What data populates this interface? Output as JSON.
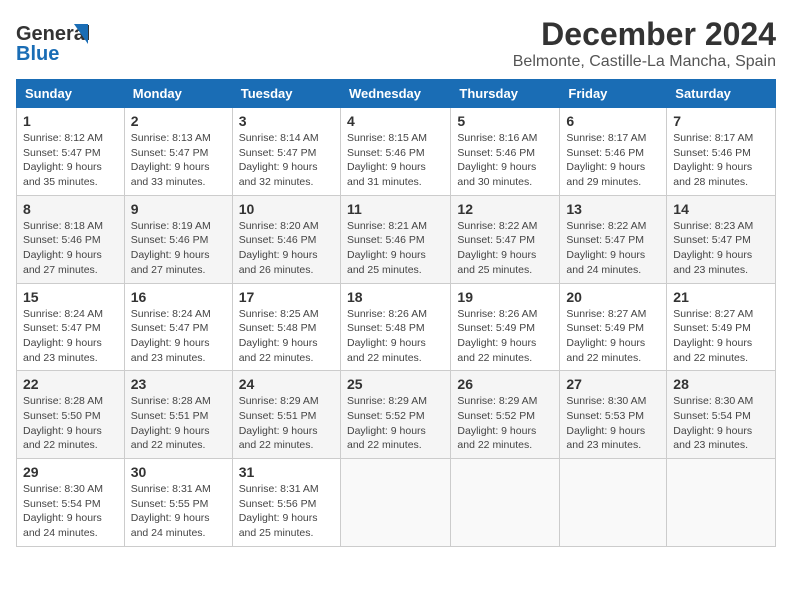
{
  "logo": {
    "line1": "General",
    "line2": "Blue"
  },
  "title": "December 2024",
  "subtitle": "Belmonte, Castille-La Mancha, Spain",
  "days_of_week": [
    "Sunday",
    "Monday",
    "Tuesday",
    "Wednesday",
    "Thursday",
    "Friday",
    "Saturday"
  ],
  "weeks": [
    [
      {
        "day": "1",
        "sunrise": "8:12 AM",
        "sunset": "5:47 PM",
        "daylight": "9 hours and 35 minutes."
      },
      {
        "day": "2",
        "sunrise": "8:13 AM",
        "sunset": "5:47 PM",
        "daylight": "9 hours and 33 minutes."
      },
      {
        "day": "3",
        "sunrise": "8:14 AM",
        "sunset": "5:47 PM",
        "daylight": "9 hours and 32 minutes."
      },
      {
        "day": "4",
        "sunrise": "8:15 AM",
        "sunset": "5:46 PM",
        "daylight": "9 hours and 31 minutes."
      },
      {
        "day": "5",
        "sunrise": "8:16 AM",
        "sunset": "5:46 PM",
        "daylight": "9 hours and 30 minutes."
      },
      {
        "day": "6",
        "sunrise": "8:17 AM",
        "sunset": "5:46 PM",
        "daylight": "9 hours and 29 minutes."
      },
      {
        "day": "7",
        "sunrise": "8:17 AM",
        "sunset": "5:46 PM",
        "daylight": "9 hours and 28 minutes."
      }
    ],
    [
      {
        "day": "8",
        "sunrise": "8:18 AM",
        "sunset": "5:46 PM",
        "daylight": "9 hours and 27 minutes."
      },
      {
        "day": "9",
        "sunrise": "8:19 AM",
        "sunset": "5:46 PM",
        "daylight": "9 hours and 27 minutes."
      },
      {
        "day": "10",
        "sunrise": "8:20 AM",
        "sunset": "5:46 PM",
        "daylight": "9 hours and 26 minutes."
      },
      {
        "day": "11",
        "sunrise": "8:21 AM",
        "sunset": "5:46 PM",
        "daylight": "9 hours and 25 minutes."
      },
      {
        "day": "12",
        "sunrise": "8:22 AM",
        "sunset": "5:47 PM",
        "daylight": "9 hours and 25 minutes."
      },
      {
        "day": "13",
        "sunrise": "8:22 AM",
        "sunset": "5:47 PM",
        "daylight": "9 hours and 24 minutes."
      },
      {
        "day": "14",
        "sunrise": "8:23 AM",
        "sunset": "5:47 PM",
        "daylight": "9 hours and 23 minutes."
      }
    ],
    [
      {
        "day": "15",
        "sunrise": "8:24 AM",
        "sunset": "5:47 PM",
        "daylight": "9 hours and 23 minutes."
      },
      {
        "day": "16",
        "sunrise": "8:24 AM",
        "sunset": "5:47 PM",
        "daylight": "9 hours and 23 minutes."
      },
      {
        "day": "17",
        "sunrise": "8:25 AM",
        "sunset": "5:48 PM",
        "daylight": "9 hours and 22 minutes."
      },
      {
        "day": "18",
        "sunrise": "8:26 AM",
        "sunset": "5:48 PM",
        "daylight": "9 hours and 22 minutes."
      },
      {
        "day": "19",
        "sunrise": "8:26 AM",
        "sunset": "5:49 PM",
        "daylight": "9 hours and 22 minutes."
      },
      {
        "day": "20",
        "sunrise": "8:27 AM",
        "sunset": "5:49 PM",
        "daylight": "9 hours and 22 minutes."
      },
      {
        "day": "21",
        "sunrise": "8:27 AM",
        "sunset": "5:49 PM",
        "daylight": "9 hours and 22 minutes."
      }
    ],
    [
      {
        "day": "22",
        "sunrise": "8:28 AM",
        "sunset": "5:50 PM",
        "daylight": "9 hours and 22 minutes."
      },
      {
        "day": "23",
        "sunrise": "8:28 AM",
        "sunset": "5:51 PM",
        "daylight": "9 hours and 22 minutes."
      },
      {
        "day": "24",
        "sunrise": "8:29 AM",
        "sunset": "5:51 PM",
        "daylight": "9 hours and 22 minutes."
      },
      {
        "day": "25",
        "sunrise": "8:29 AM",
        "sunset": "5:52 PM",
        "daylight": "9 hours and 22 minutes."
      },
      {
        "day": "26",
        "sunrise": "8:29 AM",
        "sunset": "5:52 PM",
        "daylight": "9 hours and 22 minutes."
      },
      {
        "day": "27",
        "sunrise": "8:30 AM",
        "sunset": "5:53 PM",
        "daylight": "9 hours and 23 minutes."
      },
      {
        "day": "28",
        "sunrise": "8:30 AM",
        "sunset": "5:54 PM",
        "daylight": "9 hours and 23 minutes."
      }
    ],
    [
      {
        "day": "29",
        "sunrise": "8:30 AM",
        "sunset": "5:54 PM",
        "daylight": "9 hours and 24 minutes."
      },
      {
        "day": "30",
        "sunrise": "8:31 AM",
        "sunset": "5:55 PM",
        "daylight": "9 hours and 24 minutes."
      },
      {
        "day": "31",
        "sunrise": "8:31 AM",
        "sunset": "5:56 PM",
        "daylight": "9 hours and 25 minutes."
      },
      null,
      null,
      null,
      null
    ]
  ],
  "labels": {
    "sunrise_prefix": "Sunrise: ",
    "sunset_prefix": "Sunset: ",
    "daylight_prefix": "Daylight: "
  }
}
